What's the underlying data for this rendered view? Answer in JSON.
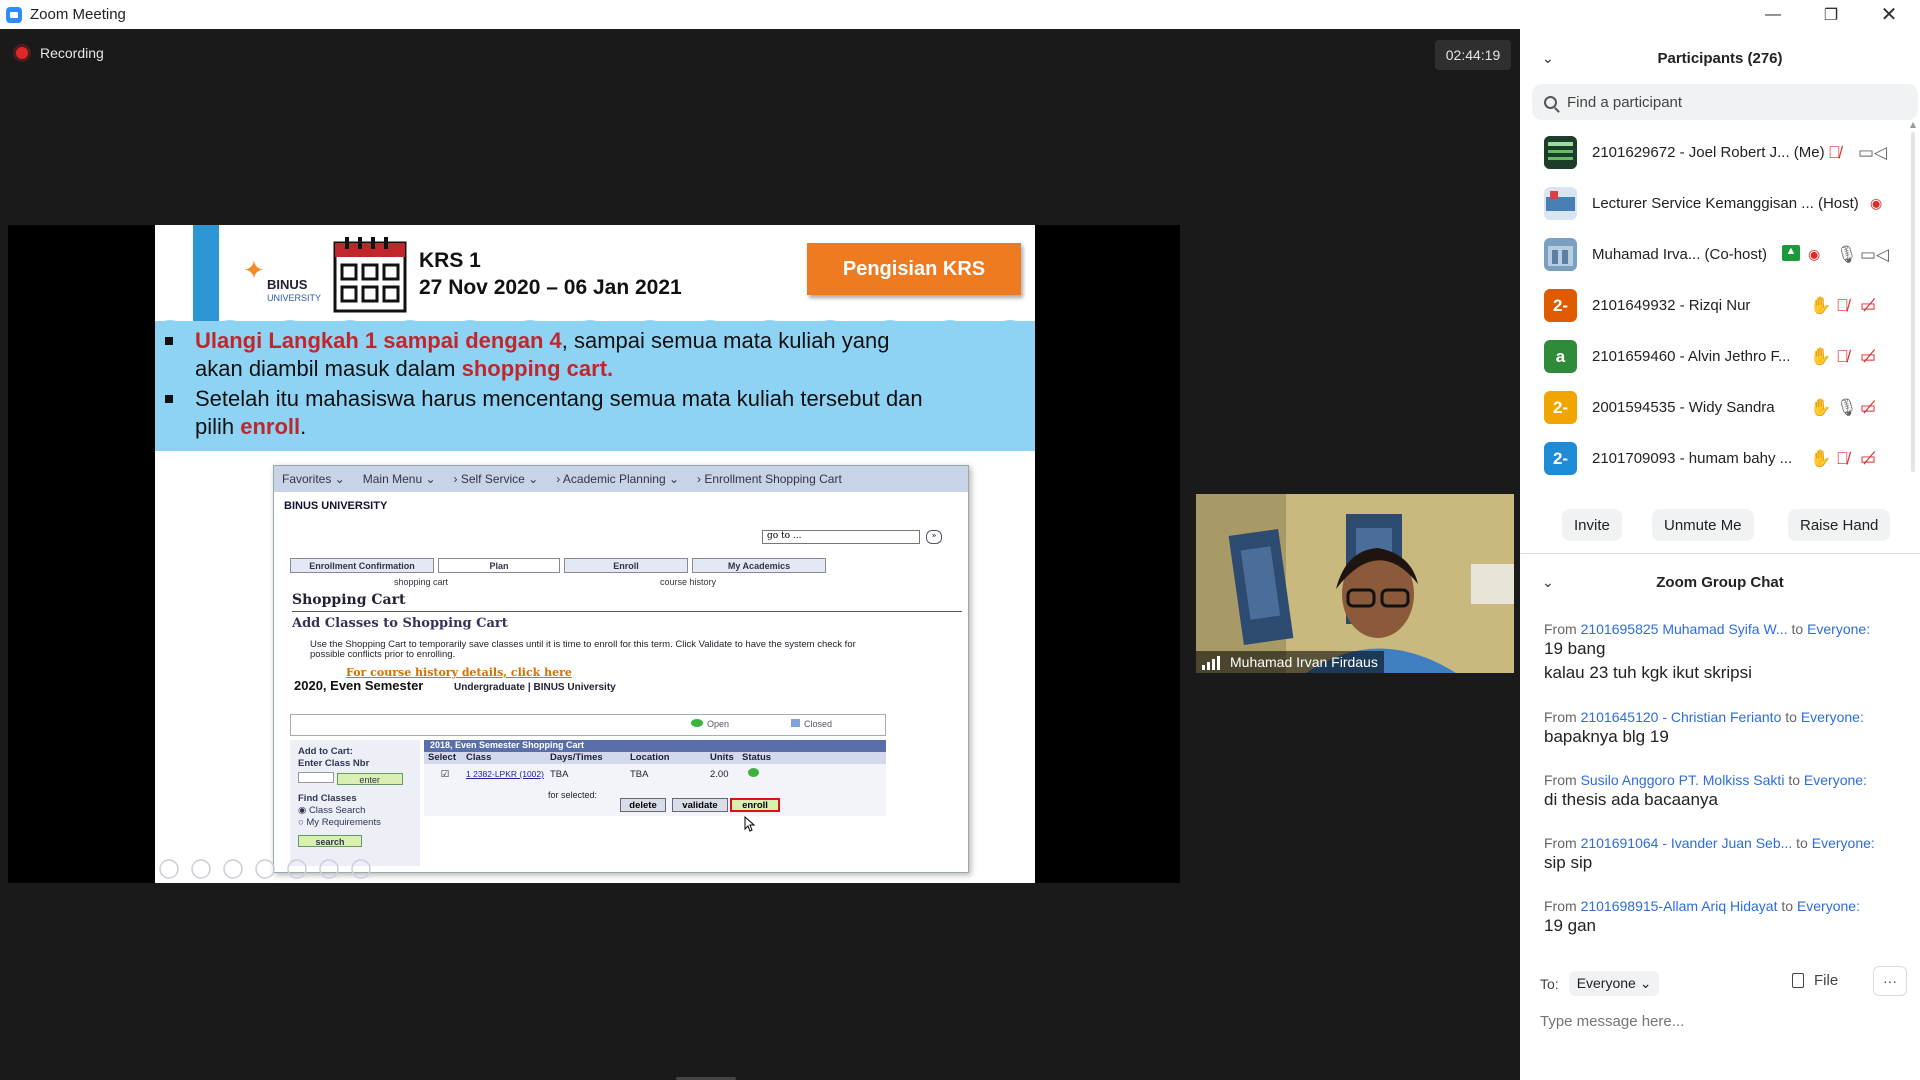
{
  "window": {
    "title": "Zoom Meeting"
  },
  "stage": {
    "recording_label": "Recording",
    "timer": "02:44:19"
  },
  "slide": {
    "logo_line1": "BINUS",
    "logo_line2": "UNIVERSITY",
    "krs_line1": "KRS 1",
    "krs_line2": "27 Nov 2020 – 06 Jan 2021",
    "badge": "Pengisian KRS",
    "bullet1_hl": "Ulangi Langkah 1 sampai dengan 4",
    "bullet1_rest": ", sampai semua mata kuliah yang",
    "bullet1_line2_a": "akan diambil masuk dalam ",
    "bullet1_line2_hl": "shopping cart.",
    "bullet2_line1": "Setelah itu mahasiswa harus mencentang semua mata kuliah tersebut dan",
    "bullet2_line2_a": "pilih ",
    "bullet2_line2_hl": "enroll",
    "bullet2_line2_end": "."
  },
  "inner": {
    "nav": [
      "Favorites ⌄",
      "Main Menu ⌄",
      "› Self Service ⌄",
      "› Academic Planning ⌄",
      "› Enrollment Shopping Cart"
    ],
    "logo": "BINUS UNIVERSITY",
    "goto": "go to ...",
    "tabs": [
      "Enrollment Confirmation",
      "Plan",
      "Enroll",
      "My Academics"
    ],
    "sub_tabs": [
      "shopping cart",
      "course history"
    ],
    "h1": "Shopping Cart",
    "h2": "Add Classes to Shopping Cart",
    "para": "Use the Shopping Cart to temporarily save classes until it is time to enroll for this term.  Click Validate to have the system check for possible conflicts prior to enrolling.",
    "link": "For course history details, click here",
    "semester": "2020, Even Semester",
    "career": "Undergraduate | BINUS University",
    "legend_open": "Open",
    "legend_closed": "Closed",
    "add_to_cart": "Add to Cart:",
    "enter_class": "Enter Class Nbr",
    "enter_btn": "enter",
    "find_classes": "Find Classes",
    "opt_search": "Class Search",
    "opt_req": "My Requirements",
    "search_btn": "search",
    "table_title": "2018, Even Semester Shopping Cart",
    "cols": [
      "Select",
      "Class",
      "Days/Times",
      "Location",
      "Units",
      "Status"
    ],
    "row": {
      "class": "1 2382-LPKR (1002)",
      "days": "TBA",
      "loc": "TBA",
      "units": "2.00"
    },
    "for_selected": "for selected:",
    "btn_delete": "delete",
    "btn_validate": "validate",
    "btn_enroll": "enroll"
  },
  "video": {
    "name": "Muhamad Irvan Firdaus"
  },
  "participants": {
    "header": "Participants (276)",
    "search_placeholder": "Find a participant",
    "list": [
      {
        "name": "2101629672 - Joel Robert J... (Me)",
        "avatar": "",
        "color": "#1b3d2a"
      },
      {
        "name": "Lecturer Service Kemanggisan ... (Host)",
        "avatar": "",
        "color": "#4a7fb5"
      },
      {
        "name": "Muhamad Irva... (Co-host)",
        "avatar": "",
        "color": "#7a9fc0"
      },
      {
        "name": "2101649932 - Rizqi Nur",
        "avatar": "2-",
        "color": "#e05a00"
      },
      {
        "name": "2101659460 - Alvin Jethro F...",
        "avatar": "a",
        "color": "#2e8b3a"
      },
      {
        "name": "2001594535 - Widy Sandra",
        "avatar": "2-",
        "color": "#f0a500"
      },
      {
        "name": "2101709093 - humam bahy ...",
        "avatar": "2-",
        "color": "#1f8ad6"
      }
    ],
    "invite": "Invite",
    "unmute": "Unmute Me",
    "raise_hand": "Raise Hand"
  },
  "chat": {
    "header": "Zoom Group Chat",
    "messages": [
      {
        "from": "2101695825 Muhamad Syifa W...",
        "to": "Everyone:",
        "lines": [
          "19 bang",
          "kalau 23 tuh kgk ikut skripsi"
        ]
      },
      {
        "from": "2101645120 - Christian Ferianto",
        "to": "Everyone:",
        "lines": [
          "bapaknya blg 19"
        ]
      },
      {
        "from": "Susilo Anggoro PT. Molkiss Sakti",
        "to": "Everyone:",
        "lines": [
          "di thesis ada bacaanya"
        ]
      },
      {
        "from": "2101691064 - Ivander Juan Seb...",
        "to": "Everyone:",
        "lines": [
          "sip sip"
        ]
      },
      {
        "from": "2101698915-Allam Ariq Hidayat",
        "to": "Everyone:",
        "lines": [
          "19 gan"
        ]
      }
    ],
    "from_word": "From",
    "to_word": "to",
    "to_label": "To:",
    "to_value": "Everyone ⌄",
    "file_label": "File",
    "more": "···",
    "placeholder": "Type message here..."
  },
  "colors": {
    "accent": "#2d8cff",
    "link_blue": "#2d6ce0",
    "mute_red": "#e02828",
    "slide_orange": "#ee7b22"
  }
}
